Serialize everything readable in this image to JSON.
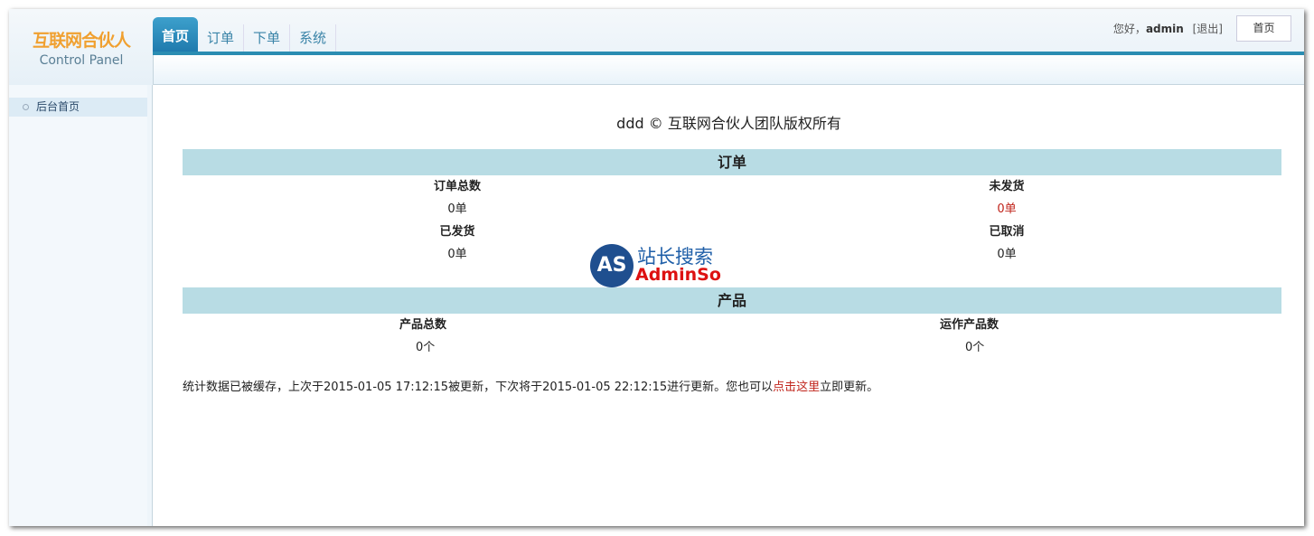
{
  "logo": {
    "cn": "互联网合伙人",
    "en": "Control Panel"
  },
  "tabs": [
    {
      "label": "首页",
      "active": true
    },
    {
      "label": "订单"
    },
    {
      "label": "下单"
    },
    {
      "label": "系统"
    }
  ],
  "user": {
    "greeting": "您好，",
    "name": "admin",
    "logout": "[退出]",
    "home_button": "首页"
  },
  "sidebar": {
    "items": [
      {
        "label": "后台首页"
      }
    ]
  },
  "main": {
    "copyright": "ddd © 互联网合伙人团队版权所有",
    "orders": {
      "title": "订单",
      "total_label": "订单总数",
      "total": "0单",
      "unshipped_label": "未发货",
      "unshipped": "0单",
      "shipped_label": "已发货",
      "shipped": "0单",
      "cancelled_label": "已取消",
      "cancelled": "0单"
    },
    "products": {
      "title": "产品",
      "total_label": "产品总数",
      "total": "0个",
      "running_label": "运作产品数",
      "running": "0个"
    },
    "note": {
      "prefix": "统计数据已被缓存，上次于2015-01-05 17:12:15被更新，下次将于2015-01-05 22:12:15进行更新。您也可以",
      "link": "点击这里",
      "suffix": "立即更新。"
    }
  },
  "watermark": {
    "logo": "AS",
    "title": "站长搜索",
    "sub": "AdminSo"
  },
  "colors": {
    "accent": "#2b8db2",
    "section_header": "#b8dce4",
    "highlight": "#c0241b"
  }
}
